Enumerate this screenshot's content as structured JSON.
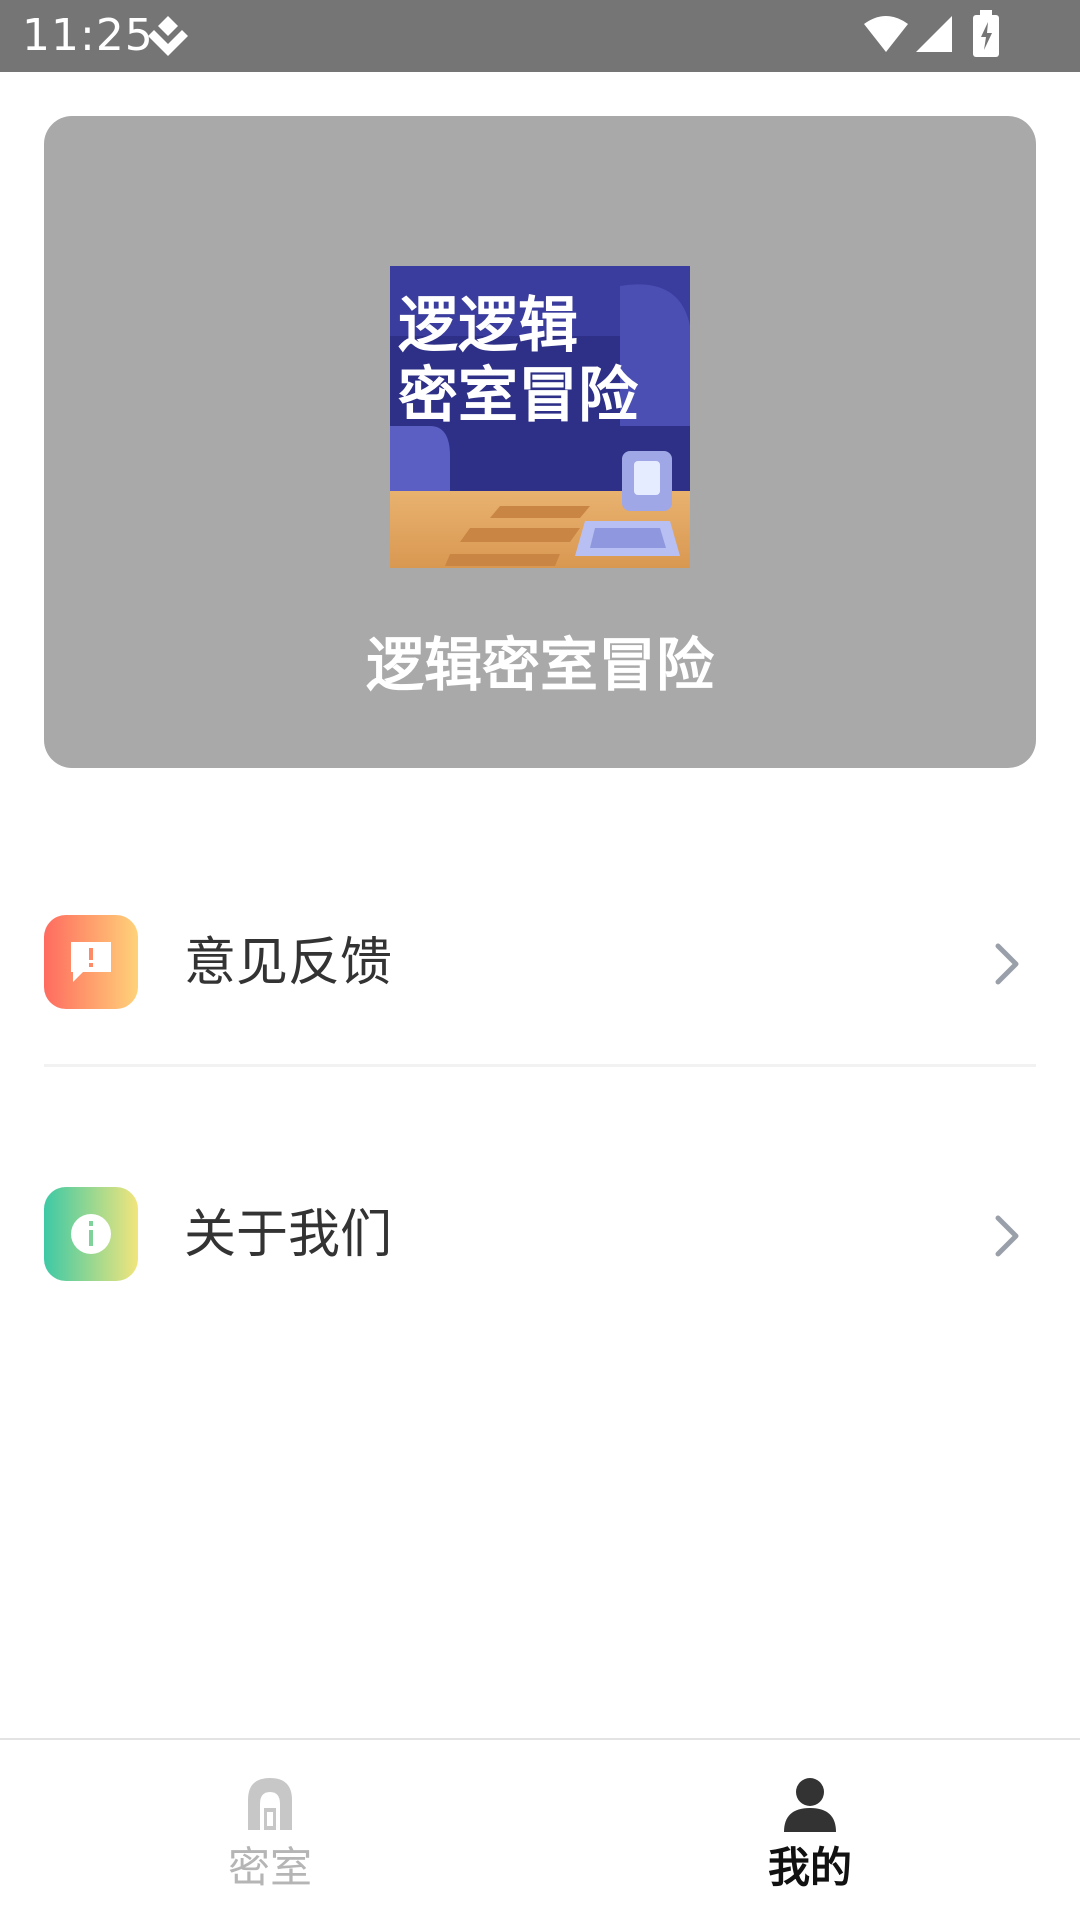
{
  "status_bar": {
    "time": "11:25",
    "icons": [
      "notification-diamond-icon",
      "wifi-icon",
      "signal-icon",
      "battery-charging-icon"
    ]
  },
  "banner": {
    "logo_text_line1": "逻逻辑",
    "logo_text_line2": "密室冒险",
    "app_name": "逻辑密室冒险",
    "background": "#a9a9a9"
  },
  "menu": {
    "items": [
      {
        "label": "意见反馈",
        "icon": "feedback-alert-icon",
        "accent": [
          "#ff6b5f",
          "#ffd27a"
        ]
      },
      {
        "label": "关于我们",
        "icon": "info-icon",
        "accent": [
          "#3dc9a5",
          "#f2e57c"
        ]
      }
    ]
  },
  "bottom_nav": {
    "tabs": [
      {
        "label": "密室",
        "icon": "door-icon",
        "active": false
      },
      {
        "label": "我的",
        "icon": "person-icon",
        "active": true
      }
    ]
  }
}
